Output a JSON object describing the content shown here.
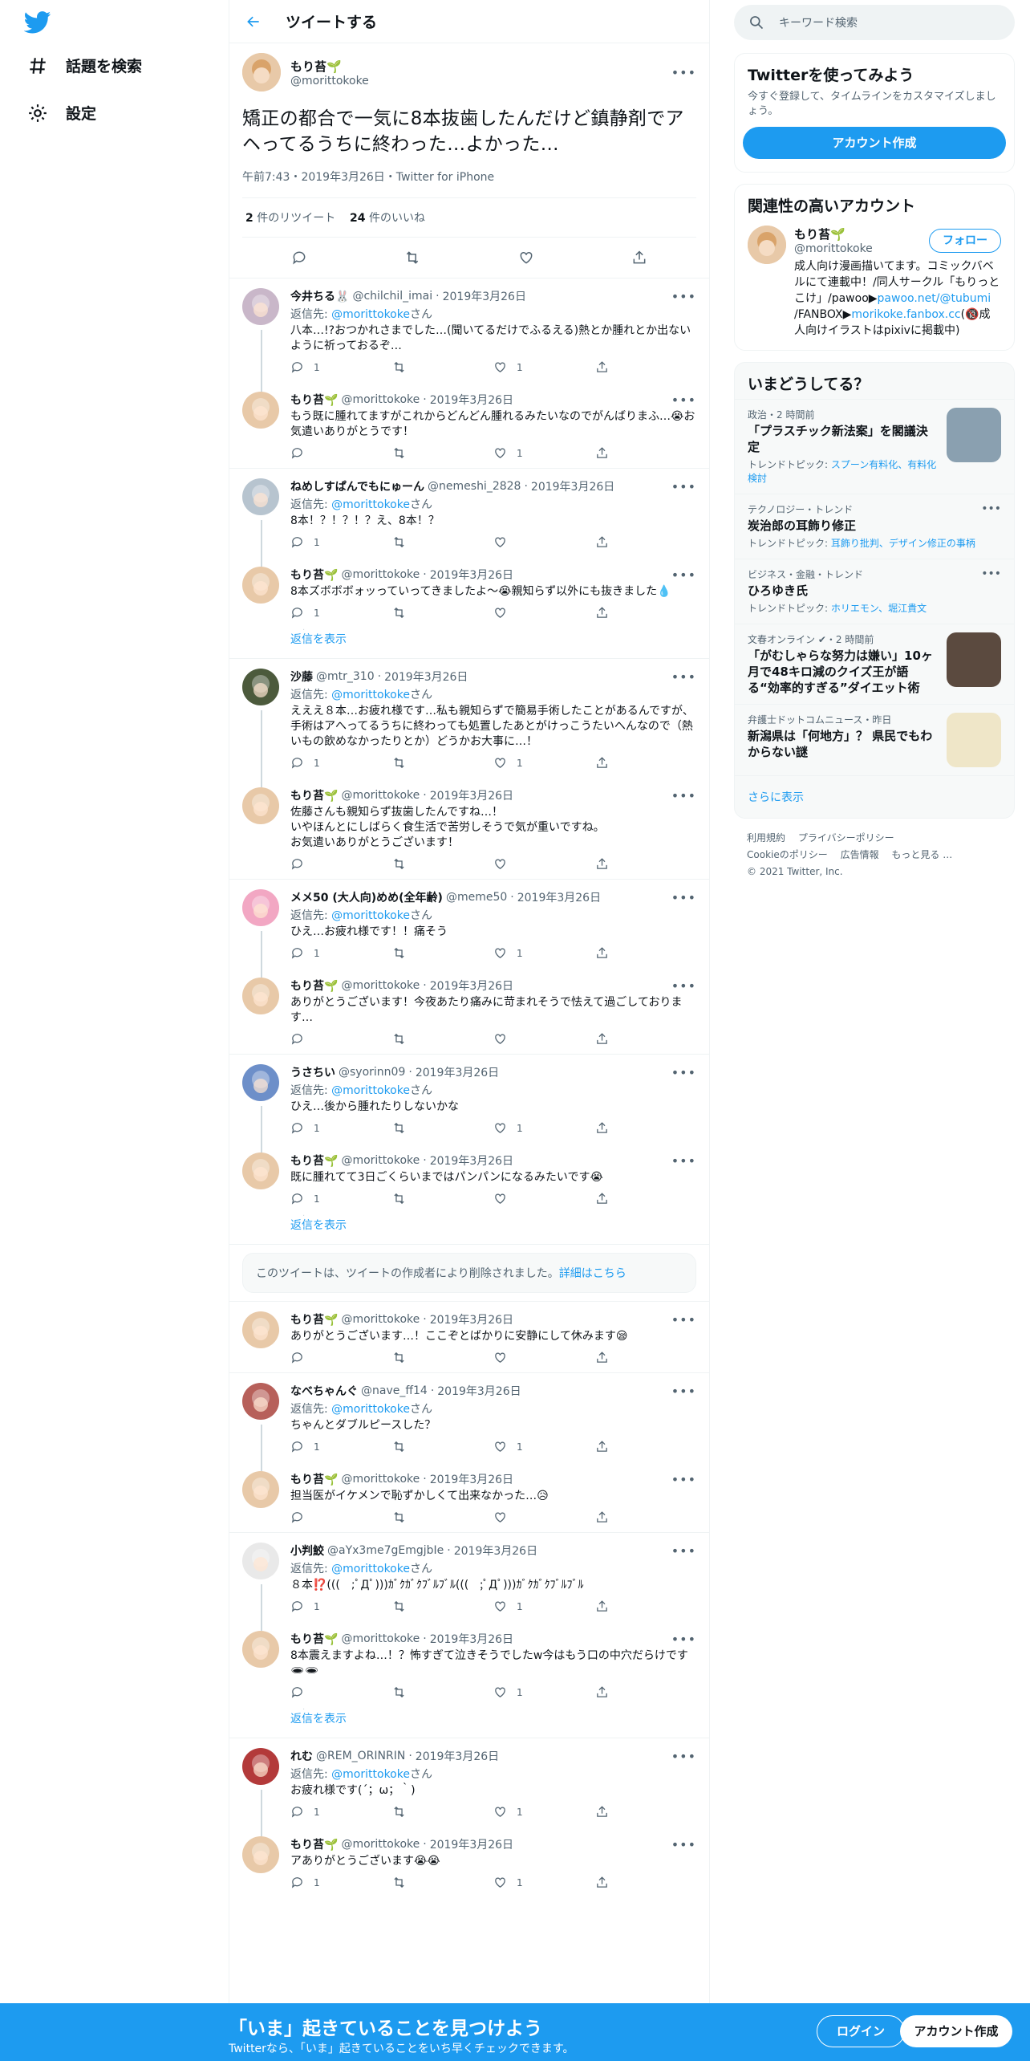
{
  "nav": {
    "explore_label": "話題を検索",
    "settings_label": "設定"
  },
  "header": {
    "title": "ツイートする"
  },
  "main_tweet": {
    "name": "もり苔🌱",
    "handle": "@morittokoke",
    "text": "矯正の都合で一気に8本抜歯したんだけど鎮静剤でアヘってるうちに終わった…よかった…",
    "meta": "午前7:43・2019年3月26日・Twitter for iPhone",
    "retweets": "2",
    "retweets_label": " 件のリツイート",
    "likes": "24",
    "likes_label": " 件のいいね"
  },
  "reply_to_prefix": "返信先: ",
  "reply_to_suffix": "さん",
  "replies": [
    {
      "name": "今井ちる🐰",
      "handle": "@chilchil_imai",
      "date": "2019年3月26日",
      "reply_to": "@morittokoke",
      "text": "八本…!?おつかれさまでした…(聞いてるだけでふるえる)熱とか腫れとか出ないように祈っておるぞ…",
      "reply_count": "1",
      "rt_count": "",
      "like_count": "1",
      "avatar_color": "#c9b7c9"
    },
    {
      "name": "もり苔🌱",
      "handle": "@morittokoke",
      "date": "2019年3月26日",
      "reply_to": "",
      "text": "もう既に腫れてますがこれからどんどん腫れるみたいなのでがんばりまふ…😭お気遣いありがとうです！",
      "reply_count": "",
      "rt_count": "",
      "like_count": "1",
      "avatar_color": "#e8c9a8"
    },
    {
      "name": "ねめしすぱんでもにゅーん",
      "handle": "@nemeshi_2828",
      "date": "2019年3月26日",
      "reply_to": "@morittokoke",
      "text": "8本！？！？！？え、8本！？",
      "reply_count": "1",
      "rt_count": "",
      "like_count": "",
      "avatar_color": "#b7c4cf"
    },
    {
      "name": "もり苔🌱",
      "handle": "@morittokoke",
      "date": "2019年3月26日",
      "reply_to": "",
      "text": "8本ズボボボォッっていってきましたよ〜😭親知らず以外にも抜きました💧",
      "reply_count": "1",
      "rt_count": "",
      "like_count": "",
      "avatar_color": "#e8c9a8"
    },
    {
      "name": "沙藤",
      "handle": "@mtr_310",
      "date": "2019年3月26日",
      "reply_to": "@morittokoke",
      "text": "えええ８本…お疲れ様です…私も親知らずで簡易手術したことがあるんですが、手術はアへってるうちに終わっても処置したあとがけっこうたいへんなので（熱いもの飲めなかったりとか）どうかお大事に…！",
      "reply_count": "1",
      "rt_count": "",
      "like_count": "1",
      "avatar_color": "#4c5a3c"
    },
    {
      "name": "もり苔🌱",
      "handle": "@morittokoke",
      "date": "2019年3月26日",
      "reply_to": "",
      "text": "佐藤さんも親知らず抜歯したんですね…！\nいやほんとにしばらく食生活で苦労しそうで気が重いですね。\nお気遣いありがとうございます！",
      "reply_count": "",
      "rt_count": "",
      "like_count": "",
      "avatar_color": "#e8c9a8"
    },
    {
      "name": "メメ50 (大人向)めめ(全年齢)",
      "handle": "@meme50",
      "date": "2019年3月26日",
      "reply_to": "@morittokoke",
      "text": "ひえ…お疲れ様です！！痛そう",
      "reply_count": "1",
      "rt_count": "",
      "like_count": "1",
      "avatar_color": "#f2a7c3"
    },
    {
      "name": "もり苔🌱",
      "handle": "@morittokoke",
      "date": "2019年3月26日",
      "reply_to": "",
      "text": "ありがとうございます！今夜あたり痛みに苛まれそうで怯えて過ごしております…",
      "reply_count": "",
      "rt_count": "",
      "like_count": "",
      "avatar_color": "#e8c9a8"
    },
    {
      "name": "うさちい",
      "handle": "@syorinn09",
      "date": "2019年3月26日",
      "reply_to": "@morittokoke",
      "text": "ひえ…後から腫れたりしないかな",
      "reply_count": "1",
      "rt_count": "",
      "like_count": "1",
      "avatar_color": "#6d8fc9"
    },
    {
      "name": "もり苔🌱",
      "handle": "@morittokoke",
      "date": "2019年3月26日",
      "reply_to": "",
      "text": "既に腫れてて3日ごくらいまではパンパンになるみたいです😭",
      "reply_count": "1",
      "rt_count": "",
      "like_count": "",
      "avatar_color": "#e8c9a8"
    },
    {
      "name": "もり苔🌱",
      "handle": "@morittokoke",
      "date": "2019年3月26日",
      "reply_to": "",
      "text": "ありがとうございます…！ここぞとばかりに安静にして休みます😪",
      "reply_count": "",
      "rt_count": "",
      "like_count": "",
      "avatar_color": "#e8c9a8"
    },
    {
      "name": "なべちゃんぐ",
      "handle": "@nave_ff14",
      "date": "2019年3月26日",
      "reply_to": "@morittokoke",
      "text": "ちゃんとダブルピースした？",
      "reply_count": "1",
      "rt_count": "",
      "like_count": "1",
      "avatar_color": "#b7605a"
    },
    {
      "name": "もり苔🌱",
      "handle": "@morittokoke",
      "date": "2019年3月26日",
      "reply_to": "",
      "text": "担当医がイケメンで恥ずかしくて出来なかった…😥",
      "reply_count": "",
      "rt_count": "",
      "like_count": "",
      "avatar_color": "#e8c9a8"
    },
    {
      "name": "小判鮫",
      "handle": "@aYx3me7gEmgjbIe",
      "date": "2019年3月26日",
      "reply_to": "@morittokoke",
      "text": "８本⁉️(((　;ﾟДﾟ)))ｶﾞｸｶﾞｸﾌﾞﾙﾌﾞﾙ(((　;ﾟДﾟ)))ｶﾞｸｶﾞｸﾌﾞﾙﾌﾞﾙ",
      "reply_count": "1",
      "rt_count": "",
      "like_count": "1",
      "avatar_color": "#e9e9e9"
    },
    {
      "name": "もり苔🌱",
      "handle": "@morittokoke",
      "date": "2019年3月26日",
      "reply_to": "",
      "text": "8本震えますよね…！？怖すぎて泣きそうでしたw今はもう口の中穴だらけです🕳🕳",
      "reply_count": "",
      "rt_count": "",
      "like_count": "1",
      "avatar_color": "#e8c9a8"
    },
    {
      "name": "れむ",
      "handle": "@REM_ORINRIN",
      "date": "2019年3月26日",
      "reply_to": "@morittokoke",
      "text": "お疲れ様です(´；ω；｀)",
      "reply_count": "1",
      "rt_count": "",
      "like_count": "1",
      "avatar_color": "#b33a3a"
    },
    {
      "name": "もり苔🌱",
      "handle": "@morittokoke",
      "date": "2019年3月26日",
      "reply_to": "",
      "text": "アありがとうございます😭😭",
      "reply_count": "1",
      "rt_count": "",
      "like_count": "1",
      "avatar_color": "#e8c9a8"
    }
  ],
  "show_replies_label": "返信を表示",
  "deleted_notice": {
    "text": "このツイートは、ツイートの作成者により削除されました。",
    "link": "詳細はこちら"
  },
  "search": {
    "placeholder": "キーワード検索"
  },
  "signup_card": {
    "title": "Twitterを使ってみよう",
    "subtitle": "今すぐ登録して、タイムラインをカスタマイズしましょう。",
    "button": "アカウント作成"
  },
  "related": {
    "title": "関連性の高いアカウント",
    "name": "もり苔🌱",
    "handle": "@morittokoke",
    "follow": "フォロー",
    "bio_1": "成人向け漫画描いてます。コミックバベルにて連載中！/同人サークル「もりっとこけ」/pawoo▶",
    "bio_link1": "pawoo.net/@tubumi",
    "bio_2": " /FANBOX▶",
    "bio_link2": "morikoke.fanbox.cc",
    "bio_3": "(🔞成人向けイラストはpixivに掲載中)"
  },
  "trends": {
    "title": "いまどうしてる？",
    "items": [
      {
        "cat": "政治・2 時間前",
        "title": "「プラスチック新法案」を閣議決定",
        "topic_prefix": "トレンドトピック: ",
        "topic": "スプーン有料化、有料化検討",
        "thumb": "#8aa0b0"
      },
      {
        "cat": "テクノロジー・トレンド",
        "title": "炭治郎の耳飾り修正",
        "topic_prefix": "トレンドトピック: ",
        "topic": "耳飾り批判、デザイン修正の事柄",
        "thumb": ""
      },
      {
        "cat": "ビジネス・金融・トレンド",
        "title": "ひろゆき氏",
        "topic_prefix": "トレンドトピック: ",
        "topic": "ホリエモン、堀江貴文",
        "thumb": ""
      },
      {
        "cat": "文春オンライン ✔・2 時間前",
        "title": "「がむしゃらな努力は嫌い」10ヶ月で48キロ減のクイズ王が語る“効率的すぎる”ダイエット術",
        "topic_prefix": "",
        "topic": "",
        "thumb": "#5b4a3f"
      },
      {
        "cat": "弁護士ドットコムニュース・昨日",
        "title": "新潟県は「何地方」？ 県民でもわからない謎",
        "topic_prefix": "",
        "topic": "",
        "thumb": "#efe6c8"
      }
    ],
    "show_more": "さらに表示"
  },
  "footer": {
    "links": [
      "利用規約",
      "プライバシーポリシー",
      "Cookieのポリシー",
      "広告情報",
      "もっと見る …"
    ],
    "copyright": "© 2021 Twitter, Inc."
  },
  "bottom_bar": {
    "headline": "「いま」起きていることを見つけよう",
    "sub": "Twitterなら、「いま」起きていることをいち早くチェックできます。",
    "login": "ログイン",
    "signup": "アカウント作成"
  },
  "colors": {
    "accent": "#1d9bf0",
    "text": "#0f1419",
    "muted": "#536471"
  }
}
